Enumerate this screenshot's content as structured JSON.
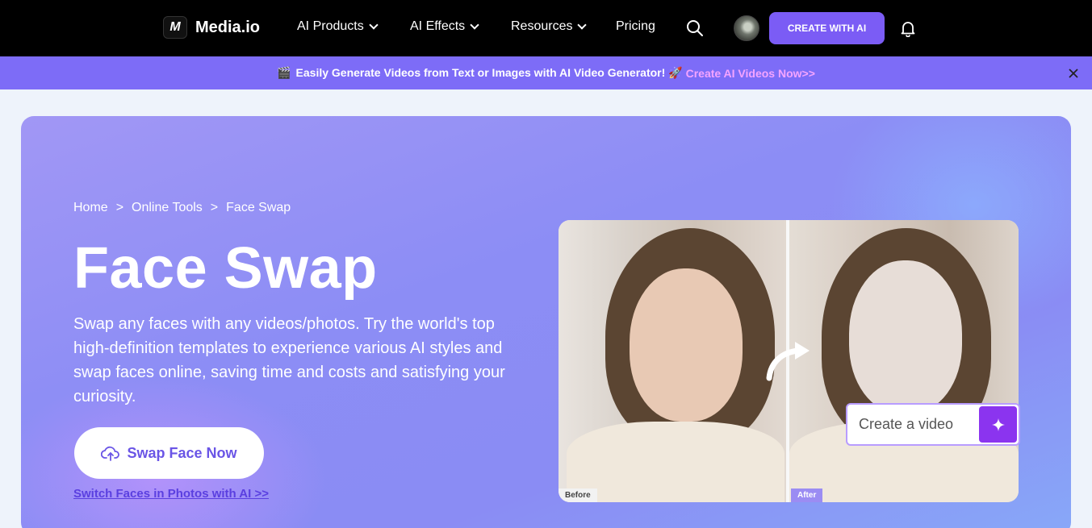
{
  "nav": {
    "logo_text": "Media.io",
    "logo_mark": "M",
    "items": [
      {
        "label": "AI Products",
        "dropdown": true
      },
      {
        "label": "AI Effects",
        "dropdown": true
      },
      {
        "label": "Resources",
        "dropdown": true
      },
      {
        "label": "Pricing",
        "dropdown": false
      }
    ],
    "cta_label": "CREATE WITH AI",
    "icons": [
      "search-icon",
      "avatar",
      "bell-icon"
    ]
  },
  "banner": {
    "emoji": "🎬",
    "text": "Easily Generate Videos from Text or Images with AI Video Generator! 🚀",
    "link": "Create AI Videos Now>>"
  },
  "hero": {
    "breadcrumb": [
      "Home",
      ">",
      "Online Tools",
      ">",
      "Face Swap"
    ],
    "title": "Face Swap",
    "description": "Swap any faces with any videos/photos. Try the world's top high-definition templates to experience various AI styles and swap faces online, saving time and costs and satisfying your curiosity.",
    "primary_button": "Swap Face Now",
    "secondary_link": "Switch Faces in Photos with AI >>"
  },
  "compare": {
    "before_label": "Before",
    "after_label": "After"
  },
  "create_box": {
    "placeholder": "Create a video"
  },
  "colors": {
    "accent": "#7b5cf5",
    "banner_bg": "#7d6cf7",
    "banner_link": "#f5a4ff",
    "spark_button": "#8b34ef"
  }
}
